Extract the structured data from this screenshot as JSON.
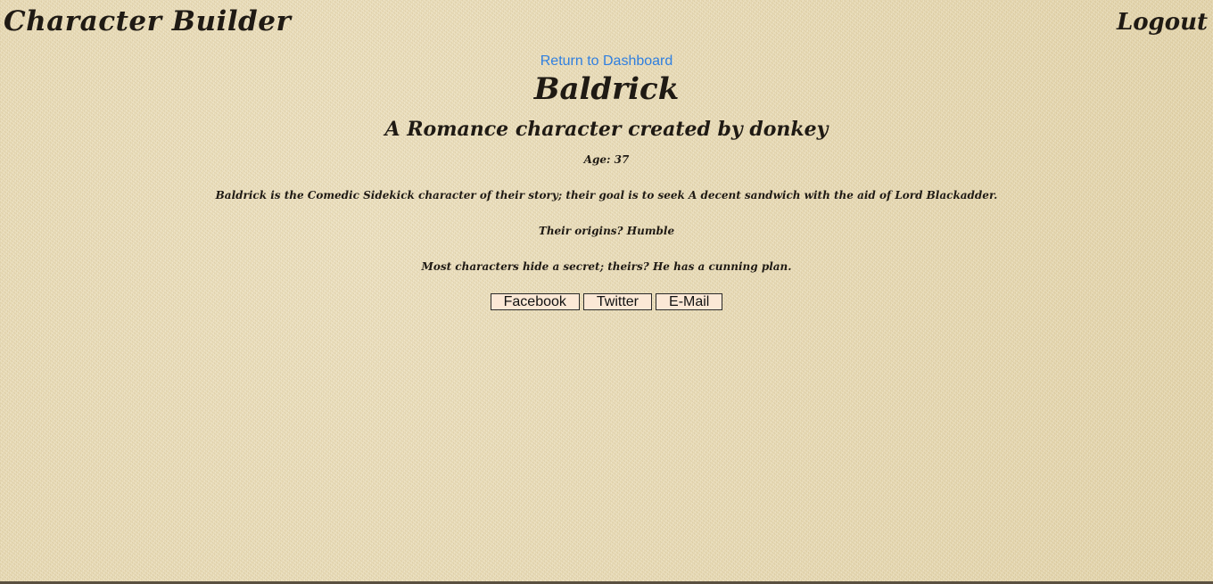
{
  "header": {
    "app_title": "Character Builder",
    "logout_label": "Logout"
  },
  "main": {
    "dashboard_link": "Return to Dashboard",
    "character_name": "Baldrick",
    "subtitle": "A Romance character created by donkey",
    "age_line": "Age: 37",
    "description": "Baldrick is the Comedic Sidekick character of their story; their goal is to seek A decent sandwich with the aid of Lord Blackadder.",
    "origins": "Their origins? Humble",
    "secret": "Most characters hide a secret; theirs? He has a cunning plan."
  },
  "share": {
    "facebook_label": "Facebook",
    "twitter_label": "Twitter",
    "email_label": "E-Mail"
  },
  "colors": {
    "link": "#2f7fe0",
    "text": "#1f1a14",
    "button_bg": "#fbe8d6",
    "background": "#e8dcb8"
  }
}
